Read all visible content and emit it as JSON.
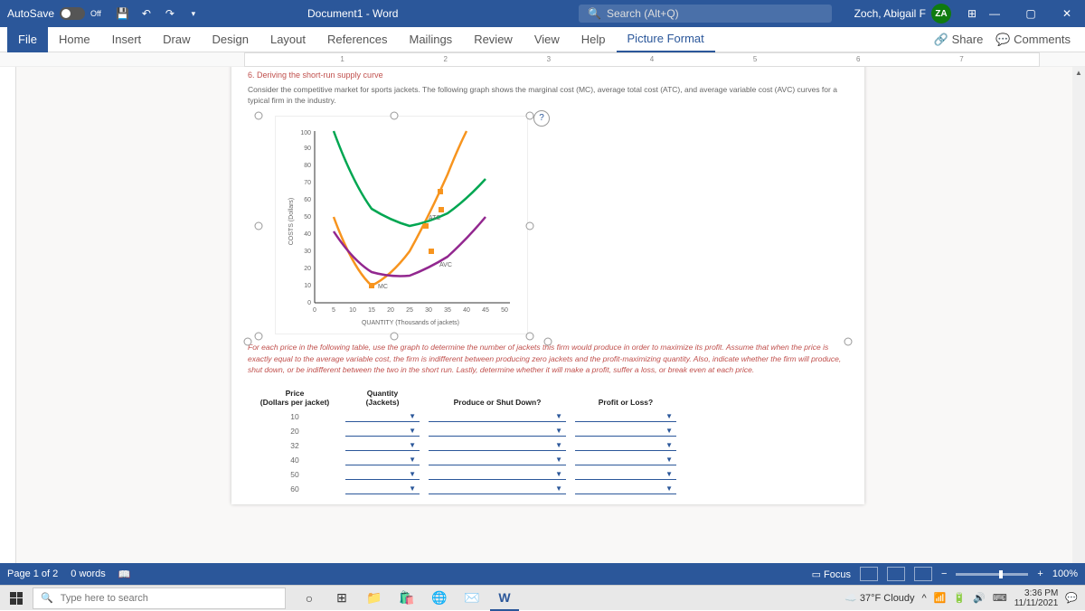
{
  "titlebar": {
    "autosave": "AutoSave",
    "autosave_state": "Off",
    "doc": "Document1  -  Word",
    "search_placeholder": "Search (Alt+Q)",
    "user": "Zoch, Abigail F",
    "initials": "ZA"
  },
  "tabs": {
    "file": "File",
    "home": "Home",
    "insert": "Insert",
    "draw": "Draw",
    "design": "Design",
    "layout": "Layout",
    "references": "References",
    "mailings": "Mailings",
    "review": "Review",
    "view": "View",
    "help": "Help",
    "picture_format": "Picture Format",
    "share": "Share",
    "comments": "Comments"
  },
  "ruler": [
    "1",
    "2",
    "3",
    "4",
    "5",
    "6",
    "7"
  ],
  "doc": {
    "section_title": "6. Deriving the short-run supply curve",
    "para1": "Consider the competitive market for sports jackets. The following graph shows the marginal cost (MC), average total cost (ATC), and average variable cost (AVC) curves for a typical firm in the industry.",
    "para2": "For each price in the following table, use the graph to determine the number of jackets this firm would produce in order to maximize its profit. Assume that when the price is exactly equal to the average variable cost, the firm is indifferent between producing zero jackets and the profit-maximizing quantity. Also, indicate whether the firm will produce, shut down, or be indifferent between the two in the short run. Lastly, determine whether it will make a profit, suffer a loss, or break even at each price.",
    "chart_ylabel": "COSTS (Dollars)",
    "chart_xlabel": "QUANTITY (Thousands of jackets)",
    "mc_label": "MC",
    "atc_label": "ATC",
    "avc_label": "AVC",
    "help": "?"
  },
  "table": {
    "h_price1": "Price",
    "h_price2": "(Dollars per jacket)",
    "h_qty1": "Quantity",
    "h_qty2": "(Jackets)",
    "h_produce": "Produce or Shut Down?",
    "h_profit": "Profit or Loss?",
    "rows": [
      "10",
      "20",
      "32",
      "40",
      "50",
      "60"
    ]
  },
  "chart_data": {
    "type": "line",
    "xlabel": "QUANTITY (Thousands of jackets)",
    "ylabel": "COSTS (Dollars)",
    "xlim": [
      0,
      50
    ],
    "ylim": [
      0,
      100
    ],
    "x_ticks": [
      0,
      5,
      10,
      15,
      20,
      25,
      30,
      35,
      40,
      45,
      50
    ],
    "y_ticks": [
      0,
      10,
      20,
      30,
      40,
      50,
      60,
      70,
      80,
      90,
      100
    ],
    "series": [
      {
        "name": "MC",
        "color": "#f7941e",
        "x": [
          5,
          10,
          15,
          20,
          25,
          30,
          35,
          40
        ],
        "y": [
          50,
          20,
          10,
          15,
          30,
          50,
          75,
          100
        ]
      },
      {
        "name": "ATC",
        "color": "#00a651",
        "x": [
          5,
          10,
          15,
          20,
          25,
          30,
          35,
          40,
          45
        ],
        "y": [
          100,
          70,
          55,
          48,
          45,
          47,
          52,
          60,
          72
        ]
      },
      {
        "name": "AVC",
        "color": "#92278f",
        "x": [
          5,
          10,
          15,
          20,
          25,
          30,
          35,
          40,
          45
        ],
        "y": [
          42,
          25,
          18,
          15,
          16,
          20,
          27,
          37,
          50
        ]
      }
    ]
  },
  "status": {
    "page": "Page 1 of 2",
    "words": "0 words",
    "focus": "Focus",
    "zoom": "100%"
  },
  "taskbar": {
    "search": "Type here to search",
    "weather": "37°F  Cloudy",
    "time": "3:36 PM",
    "date": "11/11/2021"
  }
}
